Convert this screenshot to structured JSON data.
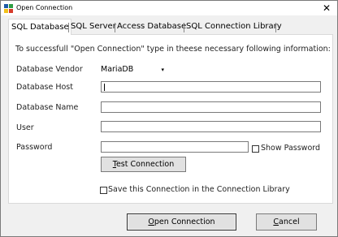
{
  "window": {
    "title": "Open Connection",
    "close_glyph": "✕"
  },
  "tabs": [
    {
      "label": "SQL Database",
      "active": true
    },
    {
      "label": "SQL Server",
      "active": false
    },
    {
      "label": "Access Database",
      "active": false
    },
    {
      "label": "SQL Connection Library",
      "active": false
    }
  ],
  "form": {
    "info": "To successfull \"Open Connection\" type in theese necessary following information:",
    "vendor_label": "Database Vendor",
    "vendor_value": "MariaDB",
    "vendor_arrow": "▾",
    "host_label": "Database Host",
    "host_value": "",
    "name_label": "Database Name",
    "name_value": "",
    "user_label": "User",
    "user_value": "",
    "password_label": "Password",
    "password_value": "",
    "show_password_label": "Show Password",
    "show_password_checked": false,
    "test_first": "T",
    "test_rest": "est Connection",
    "save_label": "Save this Connection in the Connection Library",
    "save_checked": false
  },
  "buttons": {
    "open_first": "O",
    "open_rest": "pen Connection",
    "cancel_first": "C",
    "cancel_rest": "ancel"
  },
  "colors": {
    "icon_blue": "#1e5aa8",
    "icon_green": "#2f9e44",
    "icon_yellow": "#f2c21b",
    "icon_red": "#d63a2a"
  }
}
